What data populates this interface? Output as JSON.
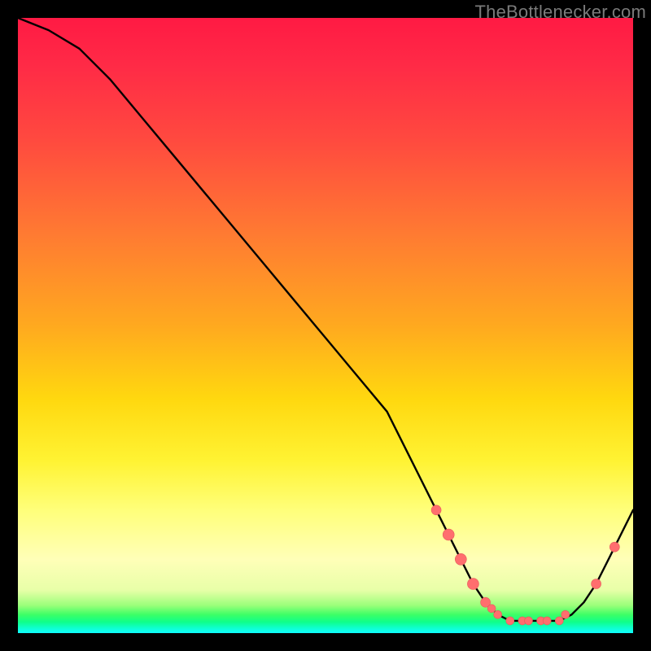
{
  "watermark": "TheBottlenecker.com",
  "colors": {
    "frame": "#000000",
    "line": "#000000",
    "marker": "#ff6e6e",
    "marker_edge": "#e55a5a"
  },
  "chart_data": {
    "type": "line",
    "title": "",
    "xlabel": "",
    "ylabel": "",
    "xlim": [
      0,
      100
    ],
    "ylim": [
      0,
      100
    ],
    "series": [
      {
        "name": "curve",
        "x": [
          0,
          5,
          10,
          15,
          20,
          25,
          30,
          35,
          40,
          45,
          50,
          55,
          60,
          63,
          65,
          68,
          70,
          72,
          74,
          76,
          78,
          80,
          82,
          84,
          86,
          88,
          90,
          92,
          94,
          96,
          100
        ],
        "values": [
          100,
          98,
          95,
          90,
          84,
          78,
          72,
          66,
          60,
          54,
          48,
          42,
          36,
          30,
          26,
          20,
          16,
          12,
          8,
          5,
          3,
          2,
          2,
          2,
          2,
          2,
          3,
          5,
          8,
          12,
          20
        ]
      }
    ],
    "markers": [
      {
        "x": 68,
        "y": 20,
        "r": 6
      },
      {
        "x": 70,
        "y": 16,
        "r": 7
      },
      {
        "x": 72,
        "y": 12,
        "r": 7
      },
      {
        "x": 74,
        "y": 8,
        "r": 7
      },
      {
        "x": 76,
        "y": 5,
        "r": 6
      },
      {
        "x": 77,
        "y": 4,
        "r": 5
      },
      {
        "x": 78,
        "y": 3,
        "r": 5
      },
      {
        "x": 80,
        "y": 2,
        "r": 5
      },
      {
        "x": 82,
        "y": 2,
        "r": 5
      },
      {
        "x": 83,
        "y": 2,
        "r": 5
      },
      {
        "x": 85,
        "y": 2,
        "r": 5
      },
      {
        "x": 86,
        "y": 2,
        "r": 5
      },
      {
        "x": 88,
        "y": 2,
        "r": 5
      },
      {
        "x": 89,
        "y": 3,
        "r": 5
      },
      {
        "x": 94,
        "y": 8,
        "r": 6
      },
      {
        "x": 97,
        "y": 14,
        "r": 6
      }
    ]
  }
}
